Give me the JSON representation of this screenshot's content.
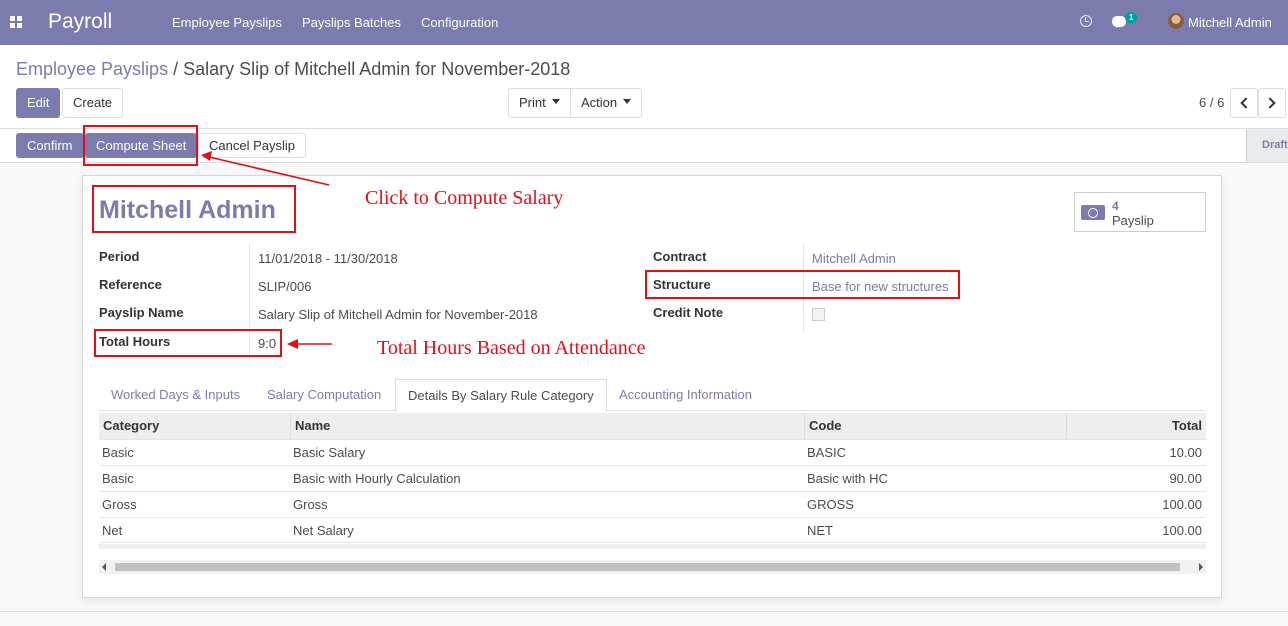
{
  "topbar": {
    "app_name": "Payroll",
    "menu": [
      "Employee Payslips",
      "Payslips Batches",
      "Configuration"
    ],
    "chat_count": "1",
    "user_name": "Mitchell Admin"
  },
  "control_panel": {
    "breadcrumb_parent": "Employee Payslips",
    "breadcrumb_separator": "/",
    "breadcrumb_current": "Salary Slip of Mitchell Admin for November-2018",
    "edit_label": "Edit",
    "create_label": "Create",
    "print_label": "Print",
    "action_label": "Action",
    "pager": "6 / 6"
  },
  "statusbar": {
    "confirm_label": "Confirm",
    "compute_label": "Compute Sheet",
    "cancel_label": "Cancel Payslip",
    "status": "Draft"
  },
  "sheet": {
    "employee": "Mitchell Admin",
    "smart_button": {
      "count": "4",
      "label": "Payslip"
    },
    "left_fields": [
      {
        "label": "Period",
        "value": "11/01/2018 - 11/30/2018"
      },
      {
        "label": "Reference",
        "value": "SLIP/006"
      },
      {
        "label": "Payslip Name",
        "value": "Salary Slip of Mitchell Admin for November-2018"
      },
      {
        "label": "Total Hours",
        "value": "9:0"
      }
    ],
    "right_fields": [
      {
        "label": "Contract",
        "value": "Mitchell Admin"
      },
      {
        "label": "Structure",
        "value": "Base for new structures"
      },
      {
        "label": "Credit Note",
        "value": ""
      }
    ],
    "tabs": [
      "Worked Days & Inputs",
      "Salary Computation",
      "Details By Salary Rule Category",
      "Accounting Information"
    ],
    "active_tab": "Details By Salary Rule Category",
    "table": {
      "columns": [
        "Category",
        "Name",
        "Code",
        "Total"
      ],
      "rows": [
        [
          "Basic",
          "Basic Salary",
          "BASIC",
          "10.00"
        ],
        [
          "Basic",
          "Basic with Hourly Calculation",
          "Basic with HC",
          "90.00"
        ],
        [
          "Gross",
          "Gross",
          "GROSS",
          "100.00"
        ],
        [
          "Net",
          "Net Salary",
          "NET",
          "100.00"
        ]
      ]
    }
  },
  "annotations": {
    "compute_note": "Click to Compute Salary",
    "hours_note": "Total Hours Based on Attendance"
  },
  "colors": {
    "brand": "#7c7bad",
    "annotation": "#e0101b"
  }
}
